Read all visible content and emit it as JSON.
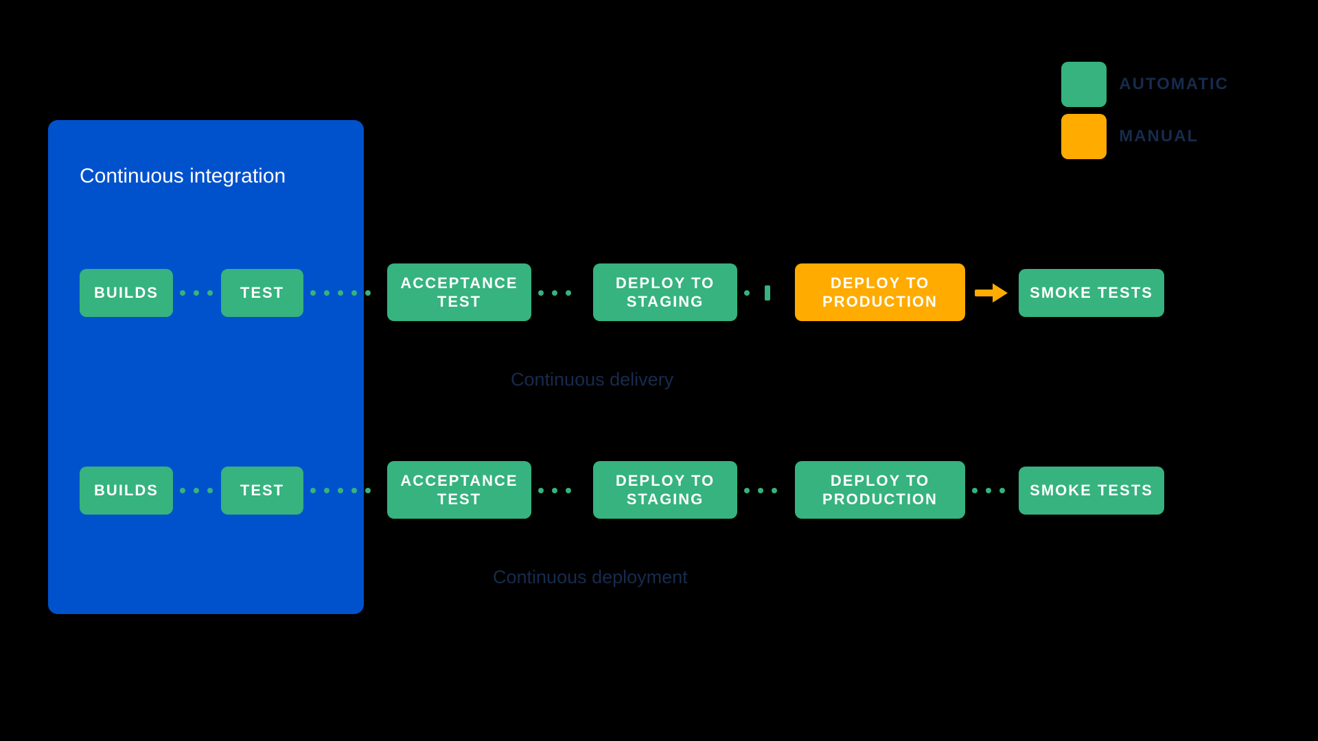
{
  "legend": {
    "automatic": "AUTOMATIC",
    "manual": "MANUAL"
  },
  "ci_title": "Continuous integration",
  "pipelines": {
    "delivery": {
      "label": "Continuous delivery",
      "stages": {
        "builds": "BUILDS",
        "test": "TEST",
        "acceptance": "ACCEPTANCE TEST",
        "staging": "DEPLOY TO STAGING",
        "production": "DEPLOY TO PRODUCTION",
        "smoke": "SMOKE TESTS"
      }
    },
    "deployment": {
      "label": "Continuous deployment",
      "stages": {
        "builds": "BUILDS",
        "test": "TEST",
        "acceptance": "ACCEPTANCE TEST",
        "staging": "DEPLOY TO STAGING",
        "production": "DEPLOY TO PRODUCTION",
        "smoke": "SMOKE TESTS"
      }
    }
  },
  "colors": {
    "automatic": "#36b37e",
    "manual": "#ffab00",
    "brand": "#0052cc",
    "text_dark": "#172b4d"
  }
}
